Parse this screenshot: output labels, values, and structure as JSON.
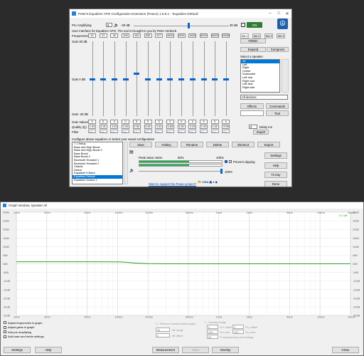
{
  "config_window": {
    "title": "Peter's Equalizer APO Configuration Extension (Peace) 1.5.9.1 - 'Equalizer Default'",
    "pre_amplifying_label": "Pre Amplifying",
    "pre_amp_value": "5",
    "pre_amp_db": "-30 dB",
    "pre_amp_max": "30 dB",
    "power_toggle": "ON",
    "interface_text": "User interface for Equalizer APO.  The tool is brought to you by Peter Verbeek.",
    "frequencies_label": "Frequencies",
    "frequencies": [
      "10",
      "21",
      "42",
      "100",
      "100",
      "333",
      "577",
      "1000",
      "2000",
      "4000",
      "8000",
      "16000",
      "20000"
    ],
    "gain_top": "Gain 30 dB",
    "gain_mid": "Gain 0 dB",
    "gain_bottom": "Gain -30 dB",
    "gain_values_label": "Gain Values",
    "gain_values": [
      "0",
      "0",
      "0",
      "0",
      "5",
      "0",
      "0",
      "0",
      "0",
      "0",
      "0",
      "0",
      "0"
    ],
    "quality_label": "Quality (Q)",
    "quality_values": [
      "1.41",
      "1.41",
      "1.41",
      "1.41",
      "1.41",
      "1.41",
      "1.41",
      "1.64",
      "1.41",
      "1.41",
      "1.41",
      "1.41",
      "2.99"
    ],
    "filter_label": "Filter",
    "delay_value": "0",
    "delay_label": "Delay ms",
    "import_label": "Import",
    "sets": [
      "Set 1",
      "Set 2",
      "Set 3",
      "Set 4"
    ],
    "flatten": "Flatten",
    "expand": "Expand",
    "compress": "Compress",
    "select_speaker_label": "Select a speaker",
    "speakers": [
      "All",
      "Left",
      "Right",
      "Center",
      "Subwoofer",
      "Left rear",
      "Right rear",
      "Left side",
      "Right side"
    ],
    "devices_select": "All devices",
    "effects": "Effects",
    "commands": "Commands",
    "test": "Test",
    "configure_label": "Configure above equalizer or Select your saved configuration",
    "configs": [
      "7.1 Setup",
      "Base and High Boost",
      "Base and High Boost 2",
      "Bass Boost",
      "Bass Boost 2",
      "Bluetooth Headset 1",
      "Bluetooth Headset 2",
      "Classic",
      "Dance",
      "Equalizer 5 Band",
      "Equalizer Default",
      "Equalizer Octave 1"
    ],
    "actions": [
      "Save",
      "Hotkey",
      "Rename",
      "Delete",
      "Shortcut",
      "Export"
    ],
    "peak_meter_label": "Peak value meter",
    "peak_50": "50%",
    "peak_100": "100%",
    "prevent_clipping": "Prevent clipping",
    "volume_100": "100%",
    "support_link": "Want to support the Peace project?",
    "settings": "Settings",
    "help": "Help",
    "to_tray": "To tray",
    "done": "Done"
  },
  "graph_window": {
    "title": "Graph window, speaker All",
    "freq_ticks": [
      "10Hz",
      "20Hz",
      "50Hz",
      "100Hz",
      "200Hz",
      "500Hz",
      "1kHz",
      "2kHz",
      "5kHz",
      "10kHz",
      "20kHz"
    ],
    "db_ticks": [
      "30dB",
      "25dB",
      "20dB",
      "15dB",
      "10dB",
      "5dB",
      "0dB",
      "-5dB",
      "-10dB",
      "-15dB",
      "-20dB",
      "-25dB",
      "-30dB"
    ],
    "current_value": "0.0 dB",
    "options": [
      "Adjust frequencies in graph",
      "Adjust gains in graph",
      "Add pre amplifying",
      "Add base and treble settings"
    ],
    "remove_measurement": "Remove measurement graph",
    "db_range_value": "30",
    "db_range_label": "dB range",
    "db_offset_value": "0",
    "db_offset_label": "dB offset",
    "overlay_label": "Overlay image",
    "x_offset": "0",
    "x_size": "100",
    "y_offset": "0",
    "y_size": "100",
    "transparency": "50",
    "x_offset_label": "% x offset",
    "x_size_label": "% x size",
    "y_offset_label": "% y offset",
    "y_size_label": "% y size",
    "transparency_label": "% transparency percentage",
    "settings": "Settings",
    "help": "Help",
    "measurement": "Measurement",
    "clear": "Clear",
    "overlay": "Overlay",
    "close": "Close"
  },
  "colors": {
    "accent": "#0078d7",
    "curve": "#2ca02c",
    "graph_bg": "#ffffff"
  },
  "chart_data": {
    "type": "line",
    "x": [
      10,
      50,
      100,
      120,
      150,
      200,
      300,
      500,
      1000,
      2000,
      5000,
      10000,
      20000
    ],
    "y": [
      1.2,
      1.2,
      1.15,
      0.9,
      0.4,
      0.1,
      0.0,
      0.0,
      0.0,
      0.0,
      0.0,
      0.0,
      0.0
    ],
    "x_scale": "log",
    "xlim": [
      10,
      20000
    ],
    "ylim": [
      -30,
      30
    ],
    "grid": true
  }
}
